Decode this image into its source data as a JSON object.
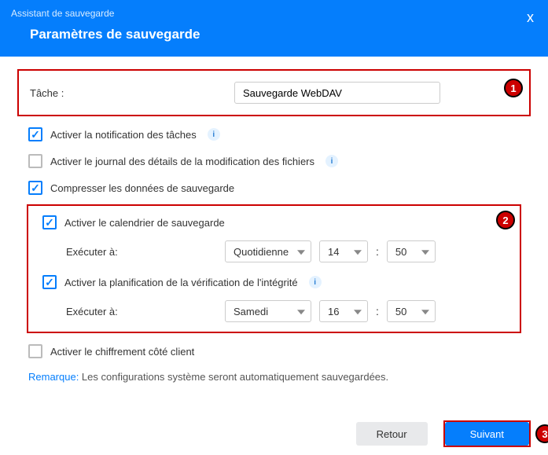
{
  "header": {
    "assistant": "Assistant de sauvegarde",
    "title": "Paramètres de sauvegarde",
    "close": "x"
  },
  "task": {
    "label": "Tâche :",
    "value": "Sauvegarde WebDAV"
  },
  "options": {
    "notify": "Activer la notification des tâches",
    "detail_log": "Activer le journal des détails de la modification des fichiers",
    "compress": "Compresser les données de sauvegarde",
    "schedule": "Activer le calendrier de sauvegarde",
    "integrity": "Activer la planification de la vérification de l'intégrité",
    "encrypt": "Activer le chiffrement côté client",
    "run_at": "Exécuter à:"
  },
  "schedule1": {
    "freq": "Quotidienne",
    "hour": "14",
    "min": "50"
  },
  "schedule2": {
    "freq": "Samedi",
    "hour": "16",
    "min": "50"
  },
  "remark": {
    "key": "Remarque:",
    "text": " Les configurations système seront automatiquement sauvegardées."
  },
  "footer": {
    "back": "Retour",
    "next": "Suivant"
  },
  "badges": {
    "b1": "1",
    "b2": "2",
    "b3": "3"
  },
  "colors": {
    "primary": "#057efc",
    "danger": "#c00"
  }
}
